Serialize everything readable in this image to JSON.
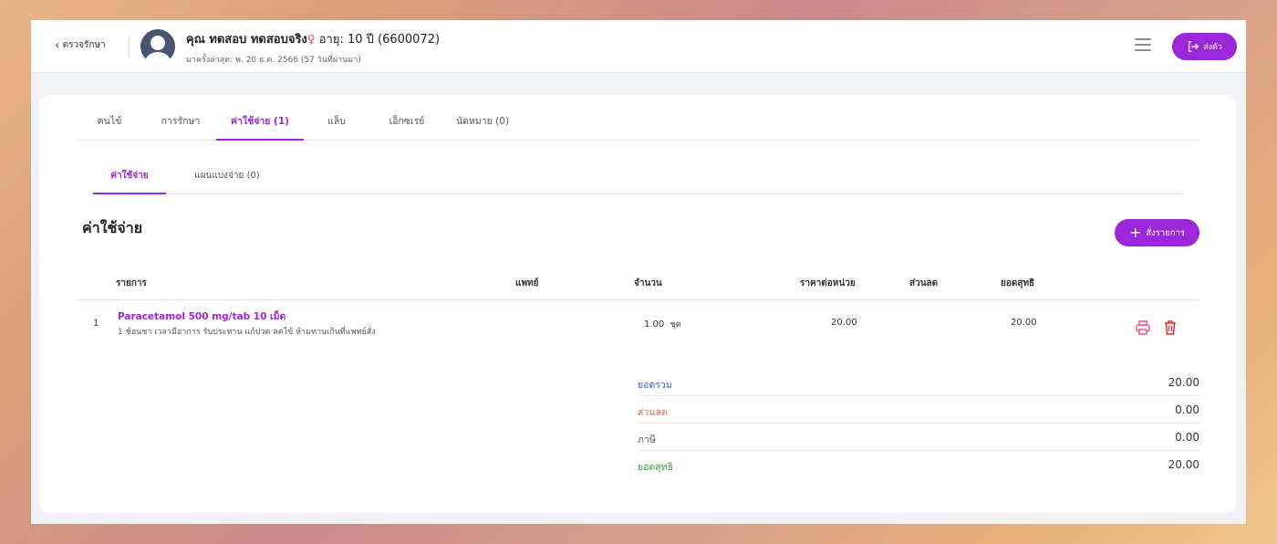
{
  "header": {
    "back_label": "ตรวจรักษา",
    "patient_name": "คุณ ทดสอบ ทดสอบจริง",
    "gender_symbol": "♀",
    "age_text": " อายุ: 10 ปี (6600072)",
    "last_visit": "มาครั้งล่าสุด: พ. 20 ธ.ค. 2566 (57 วันที่ผ่านมา)",
    "checkout_label": "ส่งตัว"
  },
  "tabs": [
    {
      "label": "คนไข้"
    },
    {
      "label": "การรักษา"
    },
    {
      "label": "ค่าใช้จ่าย (1)"
    },
    {
      "label": "แล็บ"
    },
    {
      "label": "เอ็กซเรย์"
    },
    {
      "label": "นัดหมาย (0)"
    }
  ],
  "subtabs": [
    {
      "label": "ค่าใช้จ่าย"
    },
    {
      "label": "แผนแบ่งจ่าย (0)"
    }
  ],
  "section": {
    "title": "ค่าใช้จ่าย",
    "order_button": "สั่งรายการ"
  },
  "table": {
    "headers": {
      "item": "รายการ",
      "doctor": "แพทย์",
      "qty": "จำนวน",
      "unit_price": "ราคาต่อหน่วย",
      "discount": "ส่วนลด",
      "net": "ยอดสุทธิ"
    },
    "rows": [
      {
        "no": "1",
        "name": "Paracetamol 500 mg/tab 10 เม็ด",
        "instruction": "1 ช้อนชา เวลามีอาการ รับประทาน แก้ปวด ลดไข้ ห้ามทานเกินที่แพทย์สั่ง",
        "doctor": "",
        "qty": "1.00",
        "unit": "ชุด",
        "unit_price": "20.00",
        "discount": "",
        "net": "20.00"
      }
    ]
  },
  "summary": {
    "total_label": "ยอดรวม",
    "total": "20.00",
    "discount_label": "ส่วนลด",
    "discount": "0.00",
    "tax_label": "ภาษี",
    "tax": "0.00",
    "net_label": "ยอดสุทธิ",
    "net": "20.00"
  },
  "colors": {
    "accent": "#9b27d8",
    "total": "#3b5bdb",
    "discount": "#e8734a",
    "net": "#2f9e44",
    "delete": "#e03131",
    "print": "#e84d8a"
  }
}
